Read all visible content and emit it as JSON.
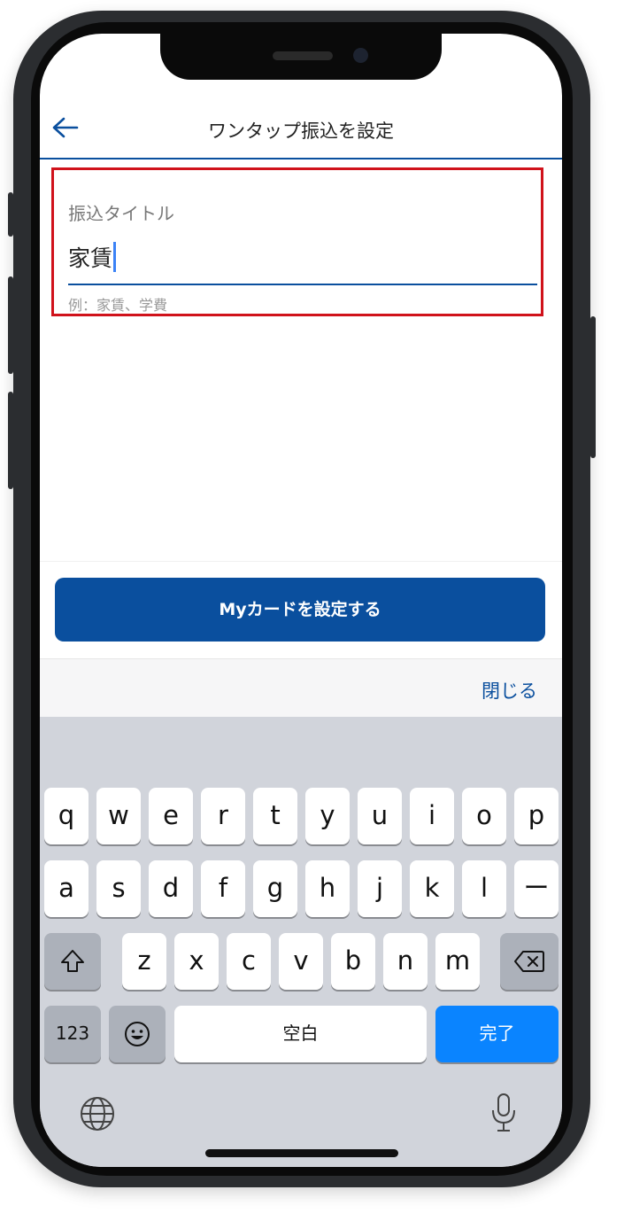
{
  "header": {
    "title": "ワンタップ振込を設定"
  },
  "field": {
    "label": "振込タイトル",
    "value": "家賃",
    "hint": "例：家賃、学費"
  },
  "action": {
    "button_label": "Myカードを設定する"
  },
  "accessory": {
    "close_label": "閉じる"
  },
  "keyboard": {
    "row1": [
      "q",
      "w",
      "e",
      "r",
      "t",
      "y",
      "u",
      "i",
      "o",
      "p"
    ],
    "row2": [
      "a",
      "s",
      "d",
      "f",
      "g",
      "h",
      "j",
      "k",
      "l",
      "ー"
    ],
    "row3": [
      "z",
      "x",
      "c",
      "v",
      "b",
      "n",
      "m"
    ],
    "numbers_label": "123",
    "space_label": "空白",
    "done_label": "完了"
  },
  "colors": {
    "brand_blue": "#0a4f9e",
    "highlight_red": "#d0121b",
    "keyboard_blue": "#0a84ff"
  },
  "icons": [
    "back-arrow-icon",
    "shift-icon",
    "backspace-icon",
    "emoji-icon",
    "globe-icon",
    "microphone-icon"
  ]
}
